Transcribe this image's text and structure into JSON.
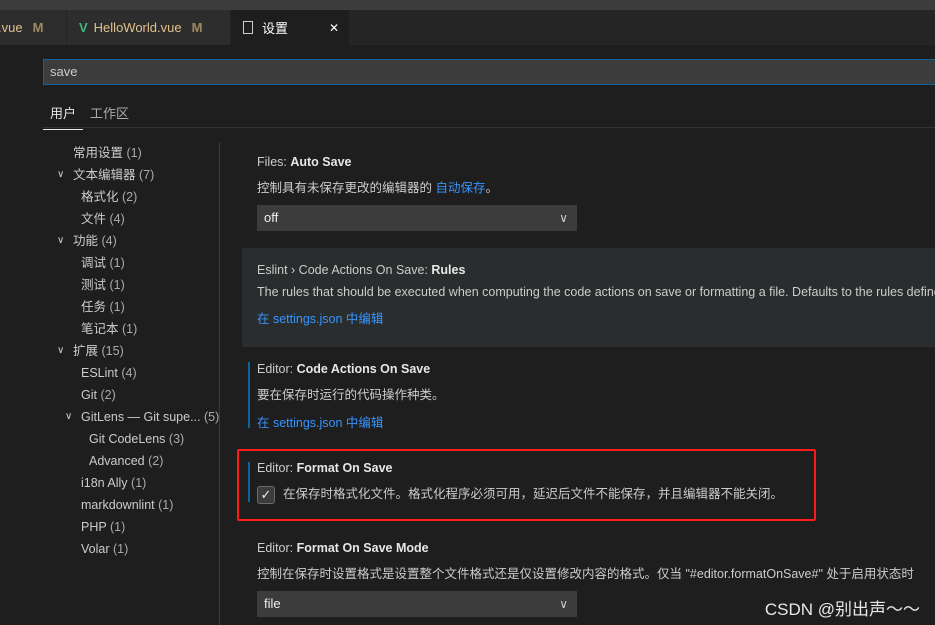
{
  "tabs": [
    {
      "label": ".vue",
      "badge": "M",
      "icon": "vue-icon"
    },
    {
      "label": "HelloWorld.vue",
      "badge": "M",
      "icon": "vue-icon"
    },
    {
      "label": "设置",
      "icon": "file-icon",
      "close": "✕"
    }
  ],
  "search": {
    "value": "save"
  },
  "scopes": [
    "用户",
    "工作区"
  ],
  "toc": [
    {
      "label": "常用设置",
      "count": "(1)",
      "level": 0
    },
    {
      "label": "文本编辑器",
      "count": "(7)",
      "level": 0,
      "expanded": true
    },
    {
      "label": "格式化",
      "count": "(2)",
      "level": 1
    },
    {
      "label": "文件",
      "count": "(4)",
      "level": 1
    },
    {
      "label": "功能",
      "count": "(4)",
      "level": 0,
      "expanded": true
    },
    {
      "label": "调试",
      "count": "(1)",
      "level": 1
    },
    {
      "label": "测试",
      "count": "(1)",
      "level": 1
    },
    {
      "label": "任务",
      "count": "(1)",
      "level": 1
    },
    {
      "label": "笔记本",
      "count": "(1)",
      "level": 1
    },
    {
      "label": "扩展",
      "count": "(15)",
      "level": 0,
      "expanded": true
    },
    {
      "label": "ESLint",
      "count": "(4)",
      "level": 1
    },
    {
      "label": "Git",
      "count": "(2)",
      "level": 1
    },
    {
      "label": "GitLens — Git supe...",
      "count": "(5)",
      "level": 1,
      "expanded": true
    },
    {
      "label": "Git CodeLens",
      "count": "(3)",
      "level": 2
    },
    {
      "label": "Advanced",
      "count": "(2)",
      "level": 2
    },
    {
      "label": "i18n Ally",
      "count": "(1)",
      "level": 1
    },
    {
      "label": "markdownlint",
      "count": "(1)",
      "level": 1
    },
    {
      "label": "PHP",
      "count": "(1)",
      "level": 1
    },
    {
      "label": "Volar",
      "count": "(1)",
      "level": 1
    }
  ],
  "settings": {
    "autosave": {
      "prefix": "Files: ",
      "name": "Auto Save",
      "desc": "控制具有未保存更改的编辑器的 ",
      "desc_link": "自动保存",
      "desc_end": "。",
      "value": "off"
    },
    "eslint": {
      "prefix": "Eslint › Code Actions On Save: ",
      "name": "Rules",
      "desc": "The rules that should be executed when computing the code actions on save or formatting a file. Defaults to the rules defined",
      "link": "在 settings.json 中编辑"
    },
    "codeactions": {
      "prefix": "Editor: ",
      "name": "Code Actions On Save",
      "desc": "要在保存时运行的代码操作种类。",
      "link": "在 settings.json 中编辑"
    },
    "formatonsave": {
      "prefix": "Editor: ",
      "name": "Format On Save",
      "desc": "在保存时格式化文件。格式化程序必须可用，延迟后文件不能保存，并且编辑器不能关闭。",
      "checked": true
    },
    "formatmode": {
      "prefix": "Editor: ",
      "name": "Format On Save Mode",
      "desc": "控制在保存时设置格式是设置整个文件格式还是仅设置修改内容的格式。仅当 \"#editor.formatOnSave#\" 处于启用状态时",
      "value": "file"
    }
  },
  "watermark": "CSDN @别出声～～",
  "colors": {
    "accent": "#0e639c",
    "link": "#3794ff",
    "highlight": "#ff1a1a"
  }
}
